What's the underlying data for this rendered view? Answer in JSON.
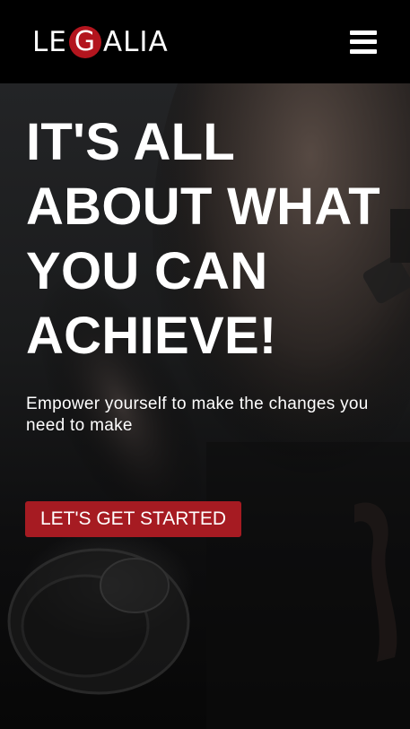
{
  "header": {
    "logo": {
      "before": "LE",
      "highlight": "G",
      "after": "ALIA"
    },
    "menu_icon": "hamburger-menu-icon"
  },
  "hero": {
    "headline": "IT'S ALL ABOUT WHAT YOU CAN ACHIEVE!",
    "subtext": "Empower yourself to make the changes you need to make",
    "cta_label": "LET'S GET STARTED"
  },
  "colors": {
    "accent": "#a61b22",
    "header_bg": "#000000",
    "text": "#ffffff"
  }
}
